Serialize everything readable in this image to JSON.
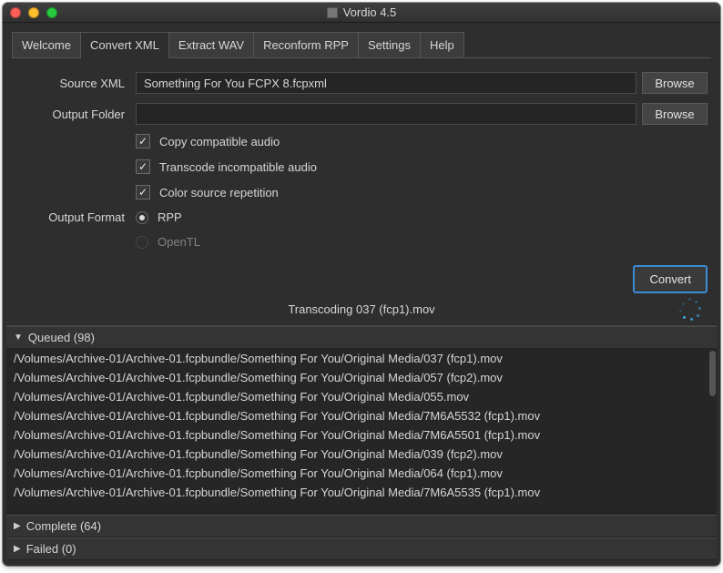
{
  "window": {
    "title": "Vordio 4.5"
  },
  "tabs": [
    {
      "label": "Welcome",
      "active": false
    },
    {
      "label": "Convert XML",
      "active": true
    },
    {
      "label": "Extract WAV",
      "active": false
    },
    {
      "label": "Reconform RPP",
      "active": false
    },
    {
      "label": "Settings",
      "active": false
    },
    {
      "label": "Help",
      "active": false
    }
  ],
  "form": {
    "source_label": "Source XML",
    "source_value": "Something For You FCPX 8.fcpxml",
    "output_label": "Output Folder",
    "output_value": "",
    "browse_label": "Browse",
    "checks": {
      "copy": "Copy compatible audio",
      "transcode": "Transcode incompatible audio",
      "color": "Color source repetition"
    },
    "format_label": "Output Format",
    "radios": {
      "rpp": "RPP",
      "opentl": "OpenTL"
    },
    "convert_label": "Convert"
  },
  "status": "Transcoding 037 (fcp1).mov",
  "sections": {
    "queued": {
      "label": "Queued (98)"
    },
    "complete": {
      "label": "Complete (64)"
    },
    "failed": {
      "label": "Failed (0)"
    }
  },
  "queued_items": [
    "/Volumes/Archive-01/Archive-01.fcpbundle/Something For You/Original Media/037 (fcp1).mov",
    "/Volumes/Archive-01/Archive-01.fcpbundle/Something For You/Original Media/057 (fcp2).mov",
    "/Volumes/Archive-01/Archive-01.fcpbundle/Something For You/Original Media/055.mov",
    "/Volumes/Archive-01/Archive-01.fcpbundle/Something For You/Original Media/7M6A5532 (fcp1).mov",
    "/Volumes/Archive-01/Archive-01.fcpbundle/Something For You/Original Media/7M6A5501 (fcp1).mov",
    "/Volumes/Archive-01/Archive-01.fcpbundle/Something For You/Original Media/039 (fcp2).mov",
    "/Volumes/Archive-01/Archive-01.fcpbundle/Something For You/Original Media/064 (fcp1).mov",
    "/Volumes/Archive-01/Archive-01.fcpbundle/Something For You/Original Media/7M6A5535 (fcp1).mov"
  ]
}
